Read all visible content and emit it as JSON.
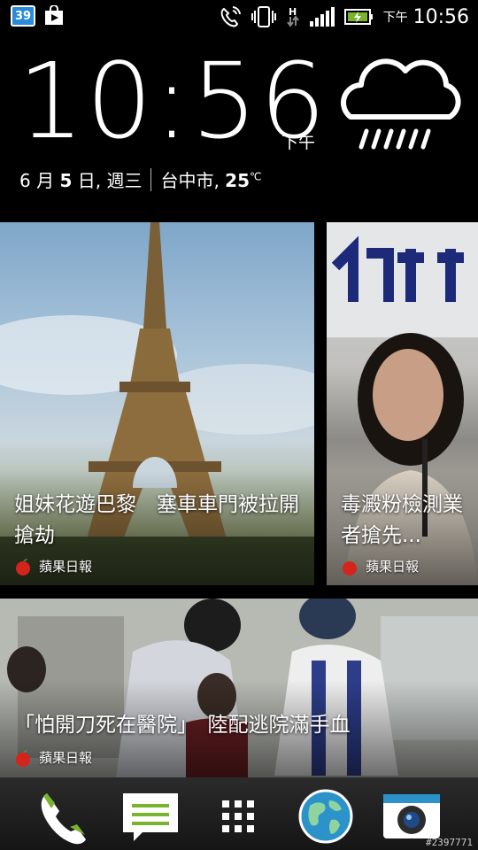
{
  "status_bar": {
    "notification_count": "39",
    "ampm": "下午",
    "time": "10:56",
    "icons": [
      "notification-badge",
      "play-store-icon",
      "call-forwarding-icon",
      "vibrate-icon",
      "hspa-data-icon",
      "signal-icon",
      "battery-charging-icon"
    ]
  },
  "clock_widget": {
    "time": "10:56",
    "ampm": "下午",
    "date_prefix": "6 月 ",
    "date_day": "5",
    "date_suffix": " 日, 週三",
    "location": "台中市, ",
    "temperature": "25",
    "temp_unit": "℃",
    "weather_icon": "rain-cloud-icon"
  },
  "news": [
    {
      "headline": "姐妹花遊巴黎　塞車車門被拉開搶劫",
      "source": "蘋果日報",
      "image": "eiffel-tower-photo"
    },
    {
      "headline": "毒澱粉檢測業者搶先...",
      "source": "蘋果日報",
      "image": "woman-speaking-photo"
    },
    {
      "headline": "「怕開刀死在醫院」　陸配逃院滿手血",
      "source": "蘋果日報",
      "image": "hospital-scene-photo"
    }
  ],
  "dock": {
    "items": [
      "phone-icon",
      "messages-icon",
      "app-drawer-icon",
      "browser-globe-icon",
      "camera-icon"
    ]
  },
  "watermark": "#2397771",
  "colors": {
    "accent_green": "#7ab32e",
    "badge_blue": "#2b8ad8"
  }
}
